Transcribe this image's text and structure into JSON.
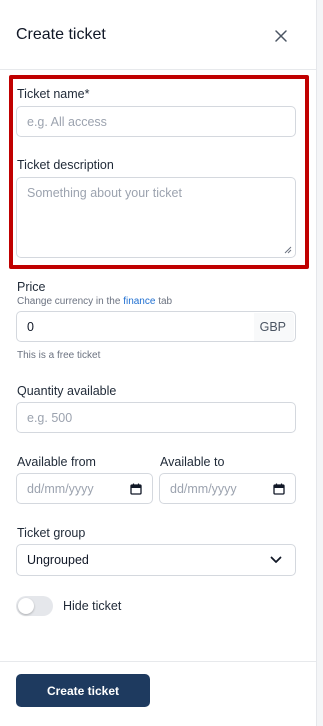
{
  "dialog": {
    "title": "Create ticket",
    "close_icon": "close-icon"
  },
  "form": {
    "ticket_name": {
      "label": "Ticket name*",
      "placeholder": "e.g. All access",
      "value": ""
    },
    "ticket_description": {
      "label": "Ticket description",
      "placeholder": "Something about your ticket",
      "value": ""
    },
    "price": {
      "label": "Price",
      "hint_prefix": "Change currency in the",
      "hint_link": "finance",
      "hint_suffix": "tab",
      "value": "0",
      "currency": "GBP",
      "note": "This is a free ticket"
    },
    "quantity": {
      "label": "Quantity available",
      "placeholder": "e.g. 500",
      "value": ""
    },
    "available_from": {
      "label": "Available from",
      "placeholder": "dd/mm/yyyy"
    },
    "available_to": {
      "label": "Available to",
      "placeholder": "dd/mm/yyyy"
    },
    "ticket_group": {
      "label": "Ticket group",
      "selected": "Ungrouped"
    },
    "hide_ticket": {
      "label": "Hide ticket",
      "checked": false
    }
  },
  "footer": {
    "submit_label": "Create ticket"
  },
  "colors": {
    "highlight": "#c00000",
    "primary_button": "#1e3a5f",
    "link": "#1f6fd1"
  }
}
